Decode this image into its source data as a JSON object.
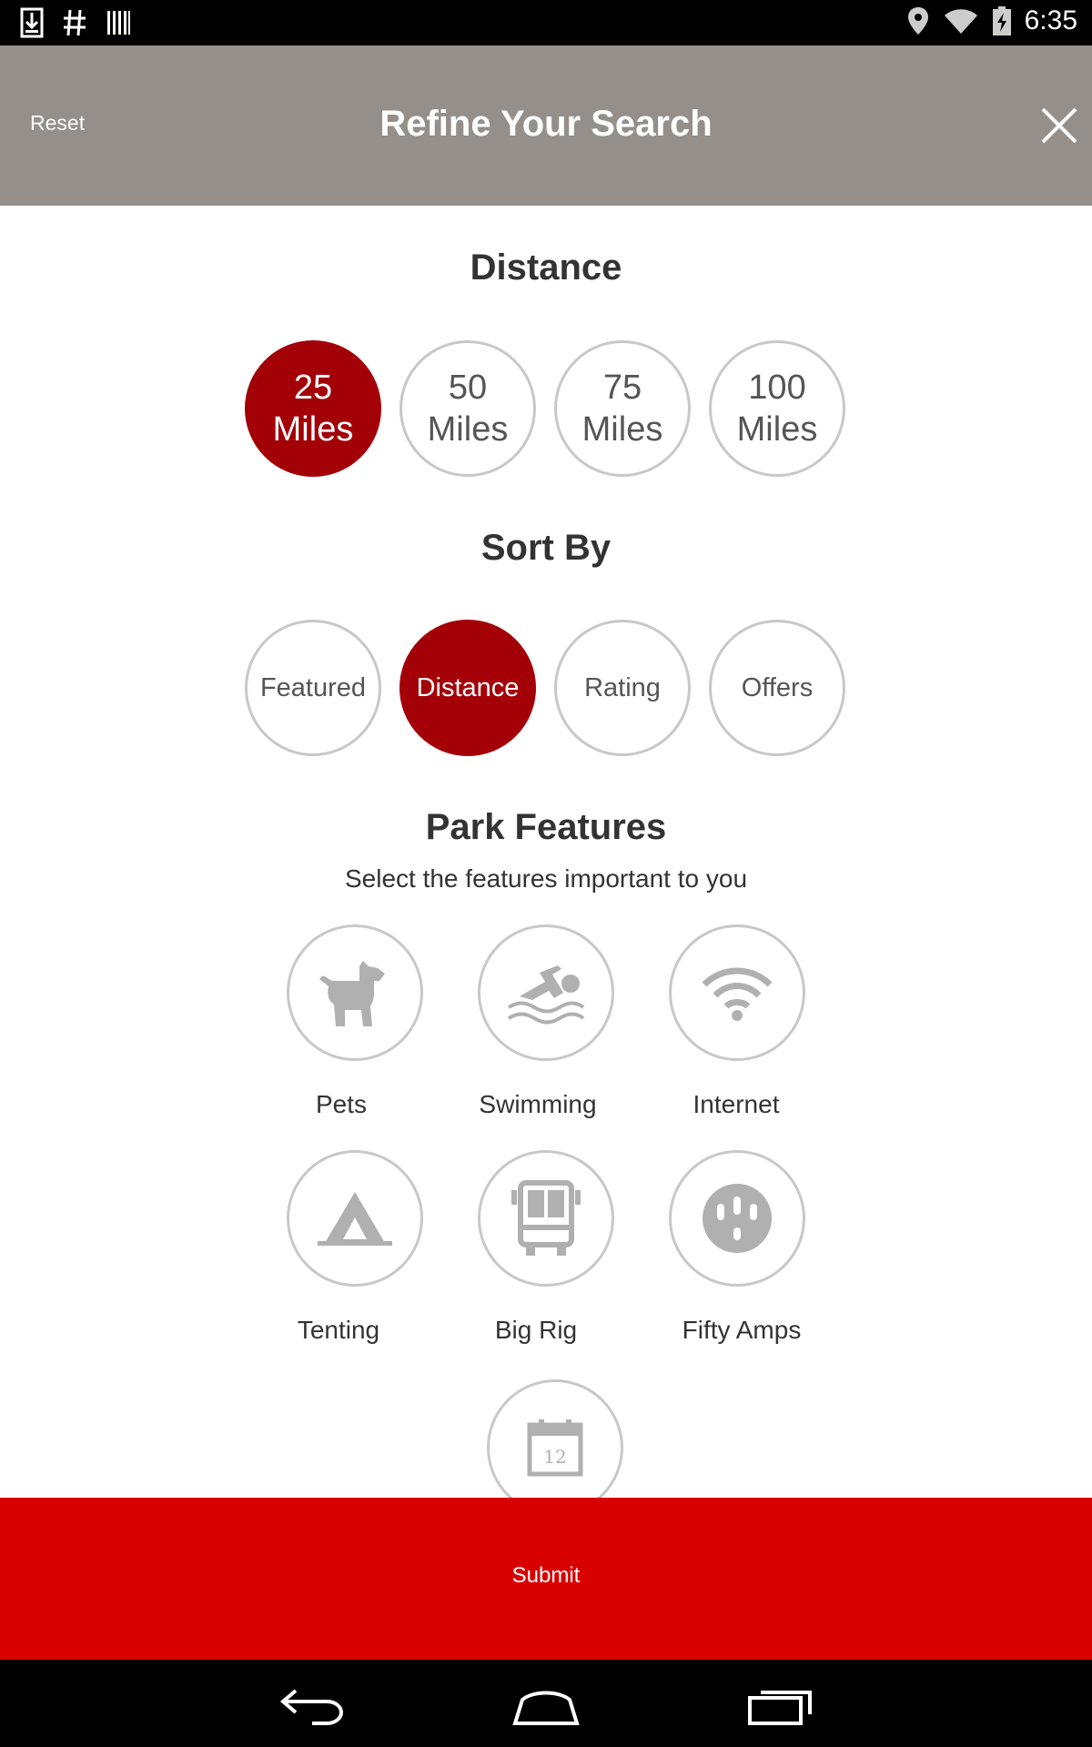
{
  "status_bar": {
    "time": "6:35",
    "left_icons": [
      "download-icon",
      "hash-icon",
      "barcode-icon"
    ],
    "right_icons": [
      "location-pin-icon",
      "wifi-icon",
      "battery-charging-icon"
    ]
  },
  "header": {
    "reset_label": "Reset",
    "title": "Refine Your Search",
    "close_icon": "close-icon",
    "background": "#948f8b"
  },
  "distance": {
    "title": "Distance",
    "options": [
      {
        "line1": "25",
        "line2": "Miles",
        "selected": true
      },
      {
        "line1": "50",
        "line2": "Miles",
        "selected": false
      },
      {
        "line1": "75",
        "line2": "Miles",
        "selected": false
      },
      {
        "line1": "100",
        "line2": "Miles",
        "selected": false
      }
    ]
  },
  "sort_by": {
    "title": "Sort By",
    "options": [
      {
        "label": "Featured",
        "selected": false
      },
      {
        "label": "Distance",
        "selected": true
      },
      {
        "label": "Rating",
        "selected": false
      },
      {
        "label": "Offers",
        "selected": false
      }
    ]
  },
  "park_features": {
    "title": "Park Features",
    "subtitle": "Select the features important to you",
    "items": [
      {
        "label": "Pets",
        "icon": "dog-icon"
      },
      {
        "label": "Swimming",
        "icon": "swimmer-icon"
      },
      {
        "label": "Internet",
        "icon": "wifi-icon"
      },
      {
        "label": "Tenting",
        "icon": "tent-icon"
      },
      {
        "label": "Big Rig",
        "icon": "bus-icon"
      },
      {
        "label": "Fifty Amps",
        "icon": "power-outlet-icon"
      },
      {
        "label": "",
        "icon": "calendar-icon",
        "calendar_day": "12"
      }
    ]
  },
  "submit": {
    "label": "Submit",
    "color": "#d90000"
  },
  "colors": {
    "selected": "#a30008",
    "icon_gray": "#b0b0b0"
  },
  "nav_bar": {
    "icons": [
      "back-icon",
      "home-icon",
      "recent-apps-icon"
    ]
  }
}
